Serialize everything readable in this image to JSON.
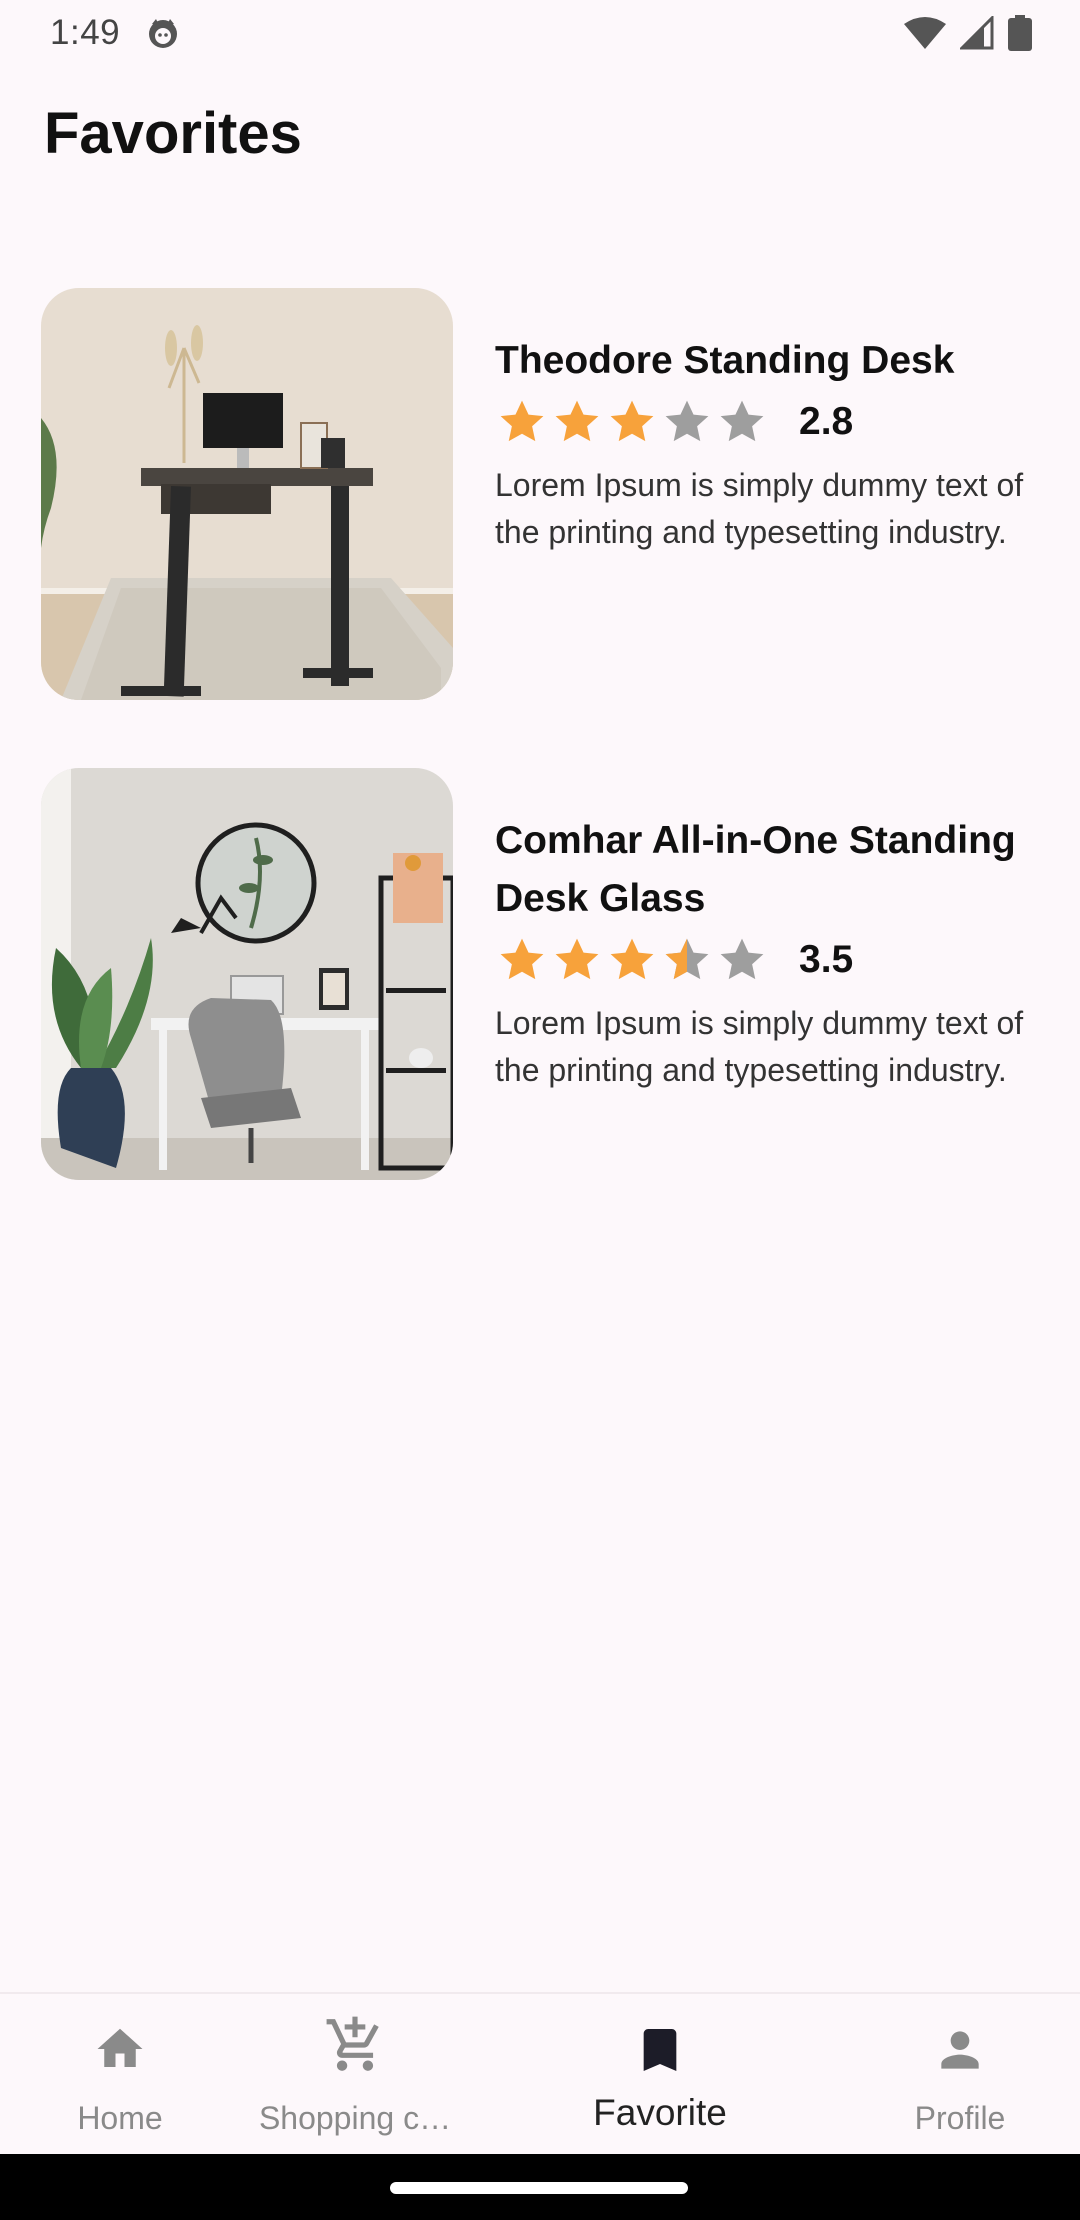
{
  "status_bar": {
    "time": "1:49"
  },
  "header": {
    "title": "Favorites"
  },
  "favorites": [
    {
      "title": "Theodore Standing Desk",
      "rating_value": "2.8",
      "rating": 2.8,
      "description": "Lorem Ipsum is simply dummy text of the printing and typesetting industry."
    },
    {
      "title": "Comhar All-in-One Standing Desk Glass",
      "rating_value": "3.5",
      "rating": 3.5,
      "description": "Lorem Ipsum is simply dummy text of the printing and typesetting industry."
    }
  ],
  "bottom_nav": {
    "items": [
      {
        "label": "Home",
        "icon": "home-icon"
      },
      {
        "label": "Shopping c…",
        "icon": "add-cart-icon"
      },
      {
        "label": "Favorite",
        "icon": "bookmark-icon",
        "active": true
      },
      {
        "label": "Profile",
        "icon": "person-icon"
      }
    ]
  },
  "colors": {
    "background": "#fdf8fb",
    "star_filled": "#f7a23b",
    "star_empty": "#9e9e9e",
    "nav_inactive": "#8a8a8a",
    "nav_active": "#1c1c28"
  }
}
